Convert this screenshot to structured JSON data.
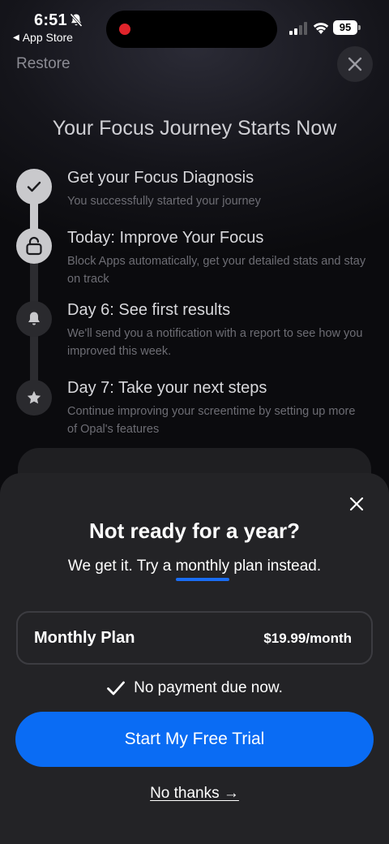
{
  "status_bar": {
    "time": "6:51",
    "back_label": "App Store",
    "battery": "95"
  },
  "header": {
    "restore_label": "Restore",
    "title": "Your Focus Journey Starts Now"
  },
  "timeline": {
    "steps": [
      {
        "title": "Get your Focus Diagnosis",
        "description": "You successfully started your journey",
        "icon": "check-icon"
      },
      {
        "title": "Today: Improve Your Focus",
        "description": "Block Apps automatically, get your detailed stats and stay on track",
        "icon": "lock-icon"
      },
      {
        "title": "Day 6: See first results",
        "description": "We'll send you a notification with a report to see how you improved this week.",
        "icon": "bell-icon"
      },
      {
        "title": "Day 7: Take your next steps",
        "description": "Continue improving your screentime by setting up more of Opal's features",
        "icon": "star-icon"
      }
    ]
  },
  "sheet": {
    "title": "Not ready for a year?",
    "subtitle_before": "We get it. Try a ",
    "subtitle_highlight": "monthly",
    "subtitle_after": " plan instead.",
    "plan": {
      "name": "Monthly Plan",
      "price": "$19.99/month"
    },
    "no_payment": "No payment due now.",
    "cta_label": "Start My Free Trial",
    "no_thanks": "No thanks →"
  },
  "colors": {
    "accent": "#0a6cf4",
    "sheet_bg": "#232326",
    "recording": "#e0242b"
  }
}
